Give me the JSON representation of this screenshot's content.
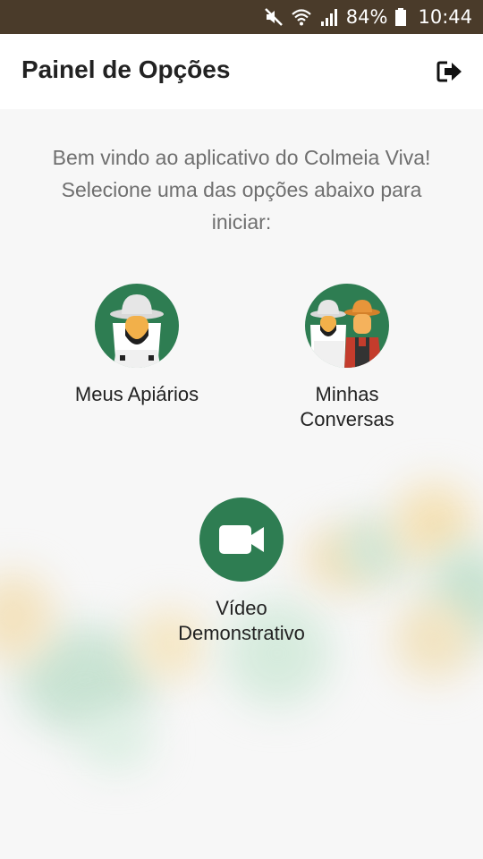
{
  "status_bar": {
    "battery": "84%",
    "time": "10:44",
    "icons": [
      "mute-icon",
      "wifi-icon",
      "signal-icon",
      "battery-icon"
    ]
  },
  "app_bar": {
    "title": "Painel de Opções",
    "logout_icon": "logout-icon"
  },
  "welcome": {
    "line1": "Bem vindo ao aplicativo do Colmeia Viva!",
    "line2": "Selecione uma das opções abaixo para",
    "line3": "iniciar:"
  },
  "options": {
    "apiaries": {
      "label": "Meus Apiários",
      "icon": "beekeeper-icon"
    },
    "conversations": {
      "label_line1": "Minhas",
      "label_line2": "Conversas",
      "icon": "beekeeper-farmer-icon"
    },
    "video": {
      "label_line1": "Vídeo",
      "label_line2": "Demonstrativo",
      "icon": "video-camera-icon"
    }
  },
  "colors": {
    "status_bar": "#4a3b2a",
    "accent_green": "#2e7d52",
    "background": "#f7f7f7",
    "text_dark": "#222222",
    "text_muted": "#6f6f6f"
  }
}
